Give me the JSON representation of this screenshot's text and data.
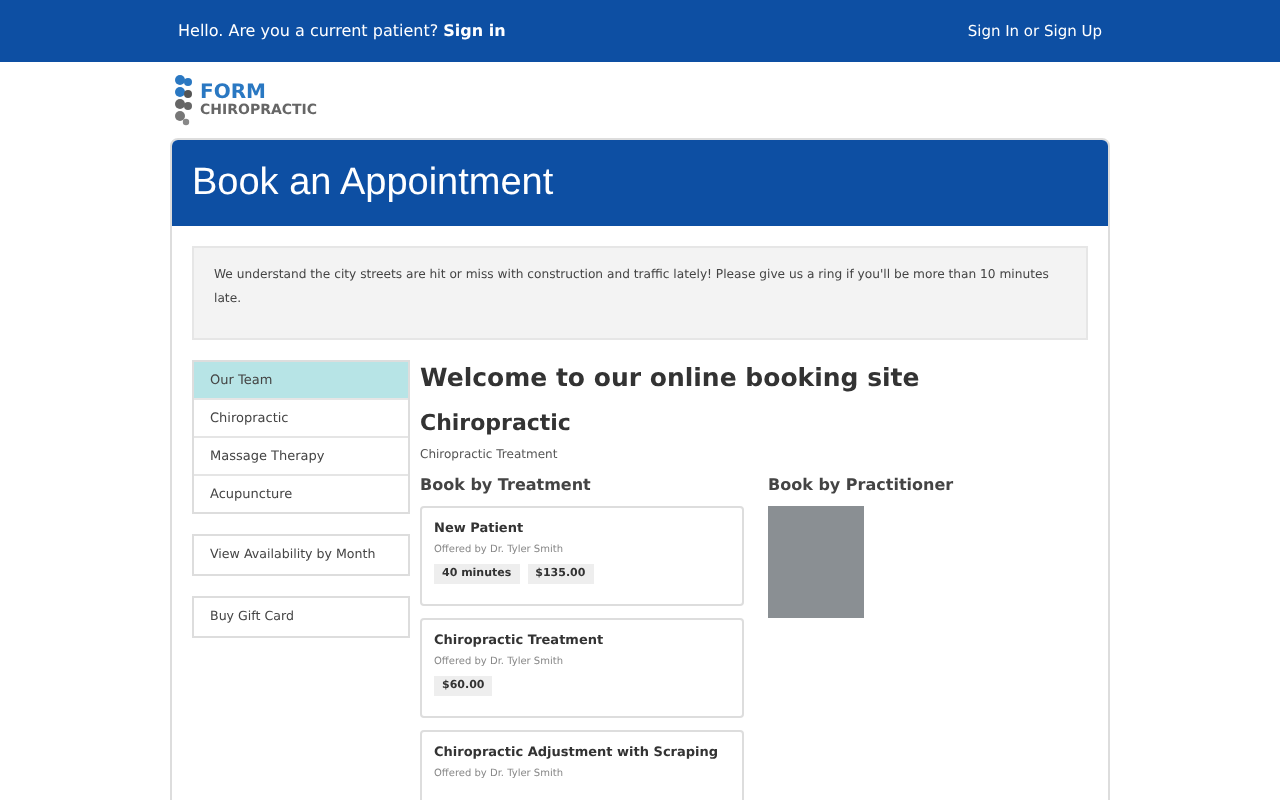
{
  "top_bar": {
    "greeting": "Hello. Are you a current patient?",
    "sign_in_link": "Sign in",
    "account_link": "Sign In or Sign Up"
  },
  "logo": {
    "name": "FORM",
    "subtitle": "CHIROPRACTIC"
  },
  "card_title": "Book an Appointment",
  "notice": "We understand the city streets are hit or miss with construction and traffic lately! Please give us a ring if you'll be more than 10 minutes late.",
  "sidebar": {
    "items": [
      {
        "label": "Our Team",
        "selected": true
      },
      {
        "label": "Chiropractic",
        "selected": false
      },
      {
        "label": "Massage Therapy",
        "selected": false
      },
      {
        "label": "Acupuncture",
        "selected": false
      }
    ],
    "buttons": [
      "View Availability by Month",
      "Buy Gift Card"
    ]
  },
  "heading": "Welcome to our online booking site",
  "section_title": "Chiropractic",
  "section_subtitle": "Chiropractic Treatment",
  "by_treatment_title": "Book by Treatment",
  "treatments": [
    {
      "name": "New Patient",
      "offered_by": "Offered by Dr. Tyler Smith",
      "tags": [
        "40 minutes",
        "$135.00"
      ]
    },
    {
      "name": "Chiropractic Treatment",
      "offered_by": "Offered by Dr. Tyler Smith",
      "tags": [
        "$60.00"
      ]
    },
    {
      "name": "Chiropractic Adjustment with Scraping",
      "offered_by": "Offered by Dr. Tyler Smith"
    }
  ],
  "by_practitioner_title": "Book by Practitioner"
}
